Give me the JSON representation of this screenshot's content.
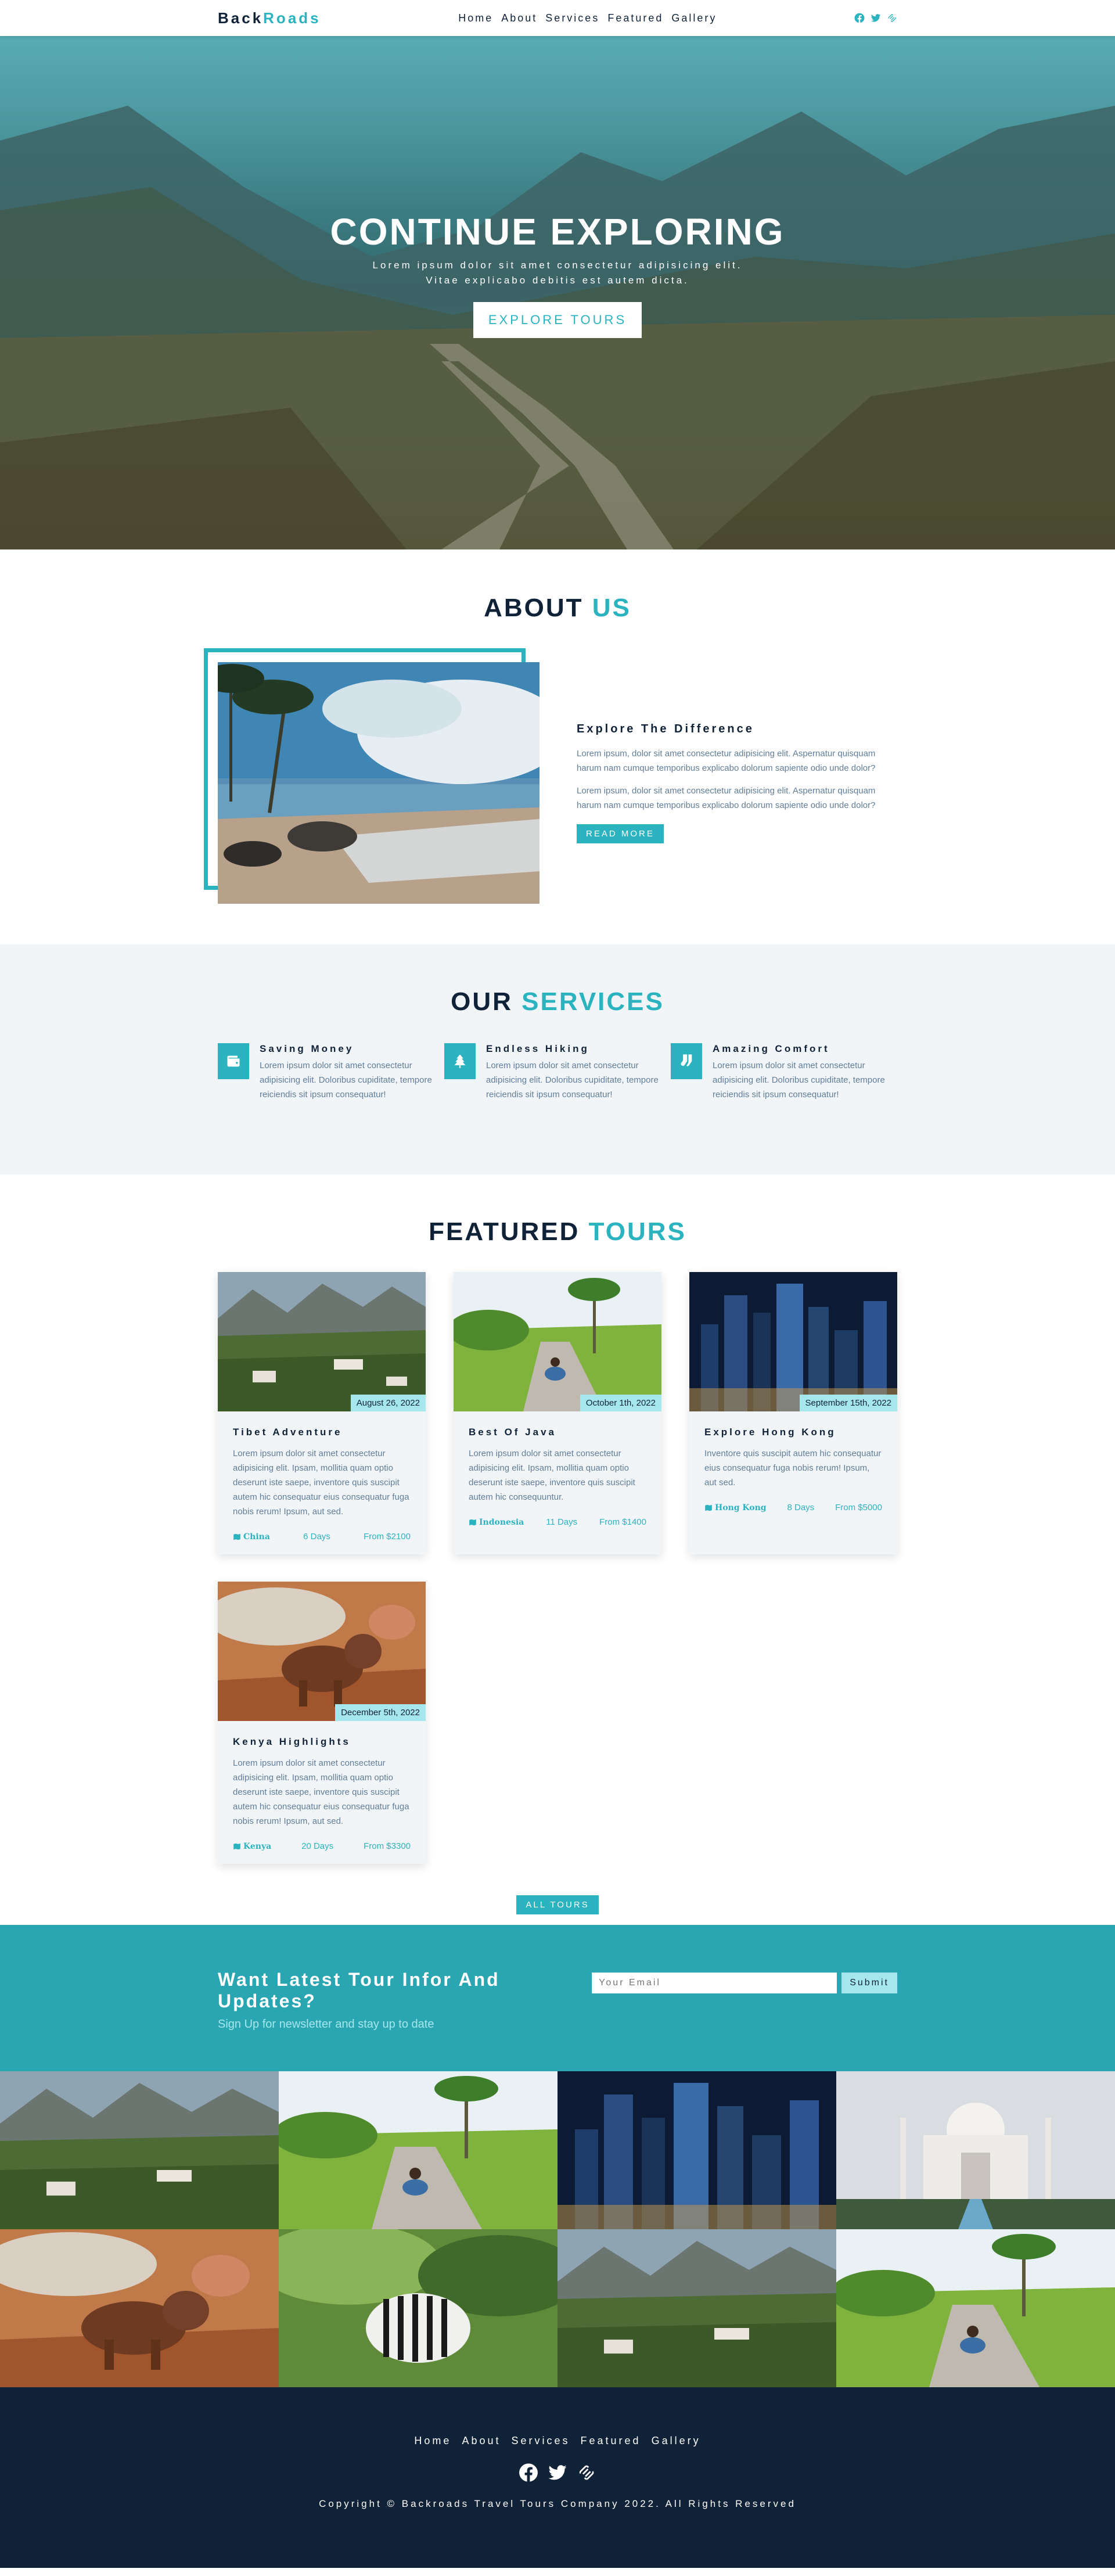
{
  "nav": {
    "logo_part1": "Back",
    "logo_part2": "Roads",
    "links": [
      "Home",
      "About",
      "Services",
      "Featured",
      "Gallery"
    ],
    "icons": [
      "facebook-icon",
      "twitter-icon",
      "squarespace-icon"
    ]
  },
  "hero": {
    "title": "CONTINUE EXPLORING",
    "text": "Lorem ipsum dolor sit amet consectetur adipisicing elit. Vitae explicabo debitis est autem dicta.",
    "button": "EXPLORE TOURS"
  },
  "about": {
    "title_part1": "ABOUT",
    "title_part2": "US",
    "heading": "Explore The Difference",
    "paragraph1": "Lorem ipsum, dolor sit amet consectetur adipisicing elit. Aspernatur quisquam harum nam cumque temporibus explicabo dolorum sapiente odio unde dolor?",
    "paragraph2": "Lorem ipsum, dolor sit amet consectetur adipisicing elit. Aspernatur quisquam harum nam cumque temporibus explicabo dolorum sapiente odio unde dolor?",
    "button": "READ MORE"
  },
  "services": {
    "title_part1": "OUR",
    "title_part2": "SERVICES",
    "items": [
      {
        "title": "Saving Money",
        "text": "Lorem ipsum dolor sit amet consectetur adipisicing elit. Doloribus cupiditate, tempore reiciendis sit ipsum consequatur!",
        "icon": "wallet-icon"
      },
      {
        "title": "Endless Hiking",
        "text": "Lorem ipsum dolor sit amet consectetur adipisicing elit. Doloribus cupiditate, tempore reiciendis sit ipsum consequatur!",
        "icon": "tree-icon"
      },
      {
        "title": "Amazing Comfort",
        "text": "Lorem ipsum dolor sit amet consectetur adipisicing elit. Doloribus cupiditate, tempore reiciendis sit ipsum consequatur!",
        "icon": "socks-icon"
      }
    ]
  },
  "tours": {
    "title_part1": "FEATURED",
    "title_part2": "TOURS",
    "items": [
      {
        "date": "August 26, 2022",
        "title": "Tibet Adventure",
        "text": "Lorem ipsum dolor sit amet consectetur adipisicing elit. Ipsam, mollitia quam optio deserunt iste saepe, inventore quis suscipit autem hic consequatur eius consequatur fuga nobis rerum! Ipsum, aut sed.",
        "country": "China",
        "duration": "6 Days",
        "price": "From $2100"
      },
      {
        "date": "October 1th, 2022",
        "title": "Best Of Java",
        "text": "Lorem ipsum dolor sit amet consectetur adipisicing elit. Ipsam, mollitia quam optio deserunt iste saepe, inventore quis suscipit autem hic consequuntur.",
        "country": "Indonesia",
        "duration": "11 Days",
        "price": "From $1400"
      },
      {
        "date": "September 15th, 2022",
        "title": "Explore Hong Kong",
        "text": "Inventore quis suscipit autem hic consequatur eius consequatur fuga nobis rerum! Ipsum, aut sed.",
        "country": "Hong Kong",
        "duration": "8 Days",
        "price": "From $5000"
      },
      {
        "date": "December 5th, 2022",
        "title": "Kenya Highlights",
        "text": "Lorem ipsum dolor sit amet consectetur adipisicing elit. Ipsam, mollitia quam optio deserunt iste saepe, inventore quis suscipit autem hic consequatur eius consequatur fuga nobis rerum! Ipsum, aut sed.",
        "country": "Kenya",
        "duration": "20 Days",
        "price": "From $3300"
      }
    ],
    "button": "ALL TOURS"
  },
  "newsletter": {
    "title": "Want Latest Tour Infor And Updates?",
    "subtitle": "Sign Up for newsletter and stay up to date",
    "placeholder": "Your Email",
    "button": "Submit"
  },
  "footer": {
    "links": [
      "Home",
      "About",
      "Services",
      "Featured",
      "Gallery"
    ],
    "copyright": "Copyright © Backroads Travel Tours Company 2022. All Rights Reserved"
  },
  "colors": {
    "accent": "#2bb3c0",
    "dark": "#102238",
    "light": "#f1f5f8",
    "pale": "#a6e6ed",
    "newsletter_bg": "#2aa6b2"
  }
}
